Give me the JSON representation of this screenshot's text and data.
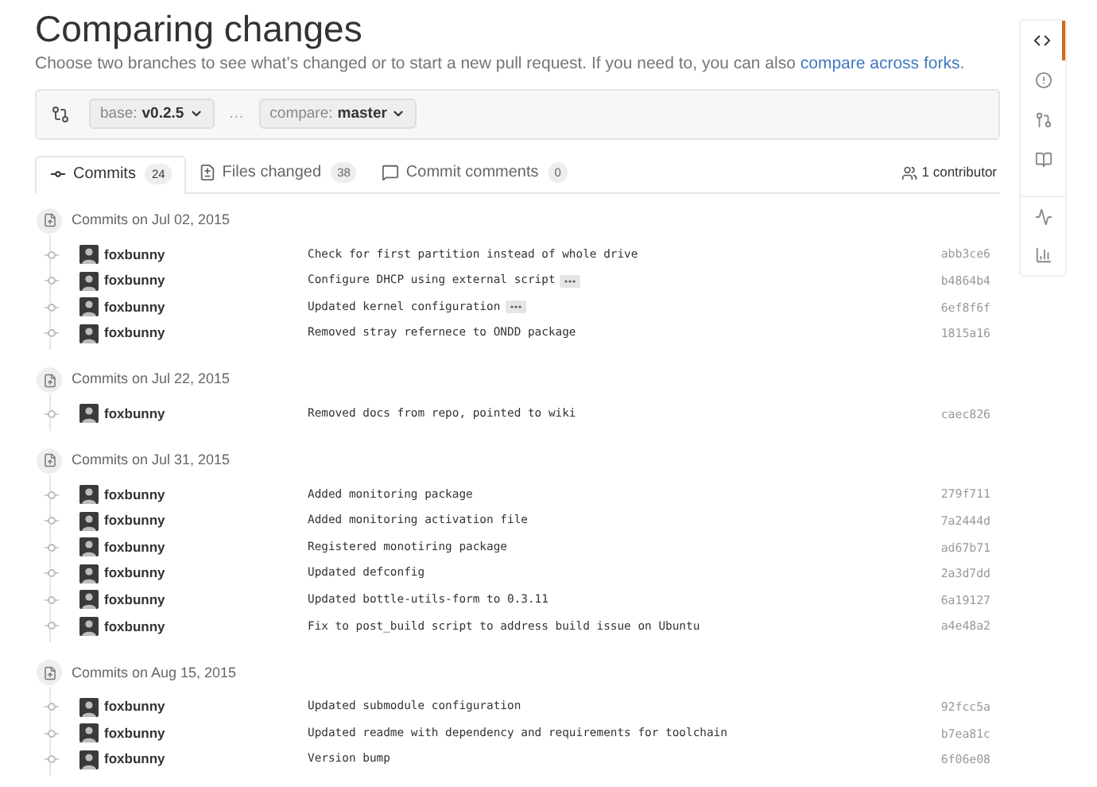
{
  "title": "Comparing changes",
  "description": {
    "text": "Choose two branches to see what’s changed or to start a new pull request. If you need to, you can also",
    "link": "compare across forks",
    "end": "."
  },
  "compare": {
    "base_label": "base:",
    "base": "v0.2.5",
    "separator": "…",
    "compare_label": "compare:",
    "compare": "master"
  },
  "tabs": [
    {
      "kind": "commits",
      "label": "Commits",
      "count": "24",
      "selected": true
    },
    {
      "kind": "files",
      "label": "Files changed",
      "count": "38",
      "selected": false
    },
    {
      "kind": "comments",
      "label": "Commit comments",
      "count": "0",
      "selected": false
    }
  ],
  "contributors": "1 contributor",
  "groups": [
    {
      "date": "Commits on Jul 02, 2015",
      "commits": [
        {
          "author": "foxbunny",
          "message": "Check for first partition instead of whole drive",
          "expandable": false,
          "sha": "abb3ce6"
        },
        {
          "author": "foxbunny",
          "message": "Configure DHCP using external script",
          "expandable": true,
          "sha": "b4864b4"
        },
        {
          "author": "foxbunny",
          "message": "Updated kernel configuration",
          "expandable": true,
          "sha": "6ef8f6f"
        },
        {
          "author": "foxbunny",
          "message": "Removed stray refernece to ONDD package",
          "expandable": false,
          "sha": "1815a16"
        }
      ]
    },
    {
      "date": "Commits on Jul 22, 2015",
      "commits": [
        {
          "author": "foxbunny",
          "message": "Removed docs from repo, pointed to wiki",
          "expandable": false,
          "sha": "caec826"
        }
      ]
    },
    {
      "date": "Commits on Jul 31, 2015",
      "commits": [
        {
          "author": "foxbunny",
          "message": "Added monitoring package",
          "expandable": false,
          "sha": "279f711"
        },
        {
          "author": "foxbunny",
          "message": "Added monitoring activation file",
          "expandable": false,
          "sha": "7a2444d"
        },
        {
          "author": "foxbunny",
          "message": "Registered monotiring package",
          "expandable": false,
          "sha": "ad67b71"
        },
        {
          "author": "foxbunny",
          "message": "Updated defconfig",
          "expandable": false,
          "sha": "2a3d7dd"
        },
        {
          "author": "foxbunny",
          "message": "Updated bottle-utils-form to 0.3.11",
          "expandable": false,
          "sha": "6a19127"
        },
        {
          "author": "foxbunny",
          "message": "Fix to post_build script to address build issue on Ubuntu",
          "expandable": false,
          "sha": "a4e48a2"
        }
      ]
    },
    {
      "date": "Commits on Aug 15, 2015",
      "commits": [
        {
          "author": "foxbunny",
          "message": "Updated submodule configuration",
          "expandable": false,
          "sha": "92fcc5a"
        },
        {
          "author": "foxbunny",
          "message": "Updated readme with dependency and requirements for toolchain",
          "expandable": false,
          "sha": "b7ea81c"
        },
        {
          "author": "foxbunny",
          "message": "Version bump",
          "expandable": false,
          "sha": "6f06e08"
        }
      ]
    }
  ],
  "sidebar": [
    {
      "kind": "code",
      "selected": true
    },
    {
      "kind": "issues",
      "selected": false
    },
    {
      "kind": "pulls",
      "selected": false
    },
    {
      "kind": "wiki",
      "selected": false
    },
    {
      "kind": "pulse",
      "selected": false
    },
    {
      "kind": "graphs",
      "selected": false
    }
  ]
}
